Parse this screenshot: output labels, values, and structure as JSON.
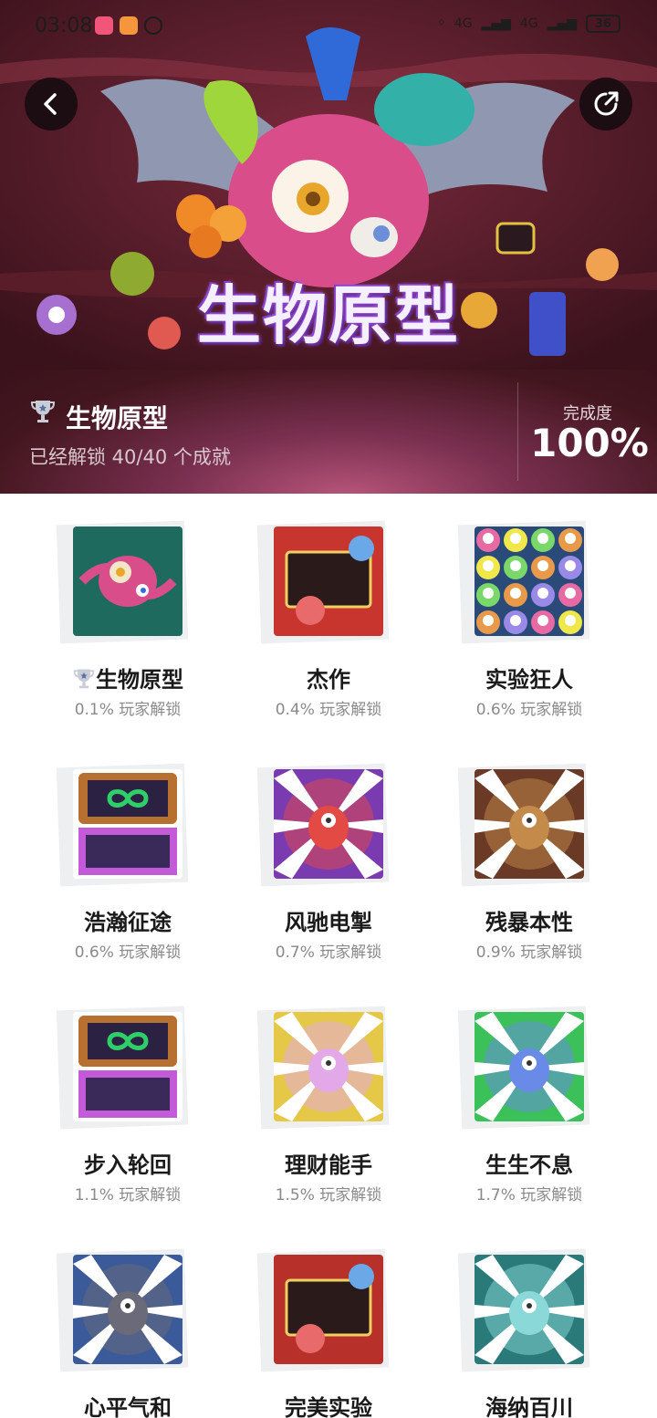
{
  "status_bar": {
    "time": "03:08",
    "signal_1": "4G",
    "signal_2": "4G",
    "battery": "36"
  },
  "hero": {
    "title_art": "生物原型"
  },
  "info": {
    "title": "生物原型",
    "subtitle": "已经解锁 40/40 个成就",
    "completion_label": "完成度",
    "completion_value": "100%"
  },
  "achievements": [
    {
      "name": "生物原型",
      "rate": "0.1% 玩家解锁",
      "trophy": true,
      "icon": "creature-brain-icon"
    },
    {
      "name": "杰作",
      "rate": "0.4% 玩家解锁",
      "trophy": false,
      "icon": "lv5-masterpiece-icon"
    },
    {
      "name": "实验狂人",
      "rate": "0.6% 玩家解锁",
      "trophy": false,
      "icon": "eyeball-swarm-icon"
    },
    {
      "name": "浩瀚征途",
      "rate": "0.6% 玩家解锁",
      "trophy": false,
      "icon": "infinity-35-icon"
    },
    {
      "name": "风驰电掣",
      "rate": "0.7% 玩家解锁",
      "trophy": false,
      "icon": "red-blob-burst-icon"
    },
    {
      "name": "残暴本性",
      "rate": "0.9% 玩家解锁",
      "trophy": false,
      "icon": "brown-blob-burst-icon"
    },
    {
      "name": "步入轮回",
      "rate": "1.1% 玩家解锁",
      "trophy": false,
      "icon": "infinity-25-icon"
    },
    {
      "name": "理财能手",
      "rate": "1.5% 玩家解锁",
      "trophy": false,
      "icon": "yellow-blob-burst-icon"
    },
    {
      "name": "生生不息",
      "rate": "1.7% 玩家解锁",
      "trophy": false,
      "icon": "green-blob-burst-icon"
    },
    {
      "name": "心平气和",
      "rate": "",
      "trophy": false,
      "icon": "gray-blob-burst-icon"
    },
    {
      "name": "完美实验",
      "rate": "",
      "trophy": false,
      "icon": "lv5-red-icon"
    },
    {
      "name": "海纳百川",
      "rate": "",
      "trophy": false,
      "icon": "teal-blob-burst-icon"
    }
  ]
}
